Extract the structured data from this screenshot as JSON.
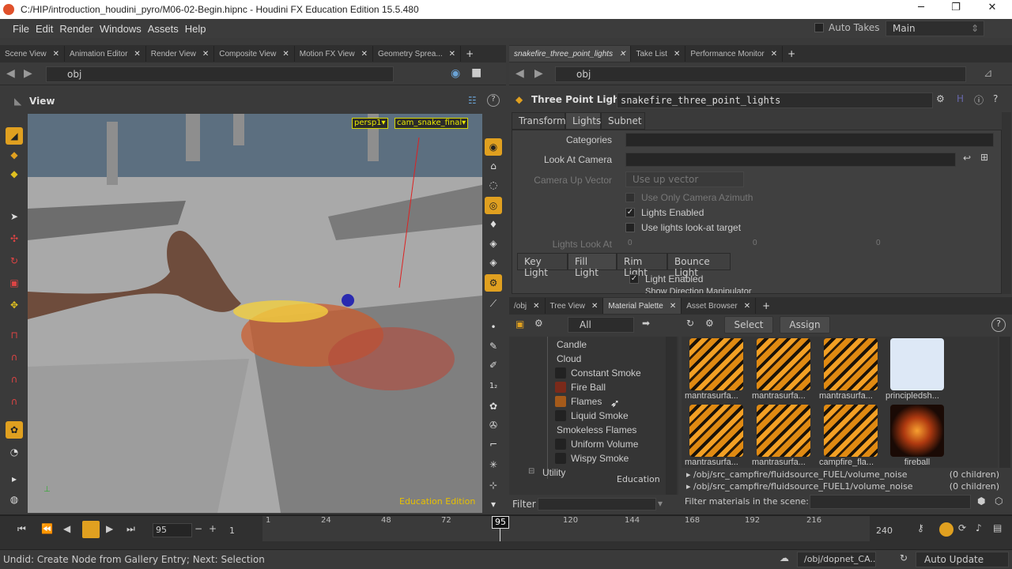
{
  "window": {
    "title": "C:/HIP/introduction_houdini_pyro/M06-02-Begin.hipnc - Houdini FX Education Edition 15.5.480",
    "min": "─",
    "max": "❐",
    "close": "✕"
  },
  "menu": [
    "File",
    "Edit",
    "Render",
    "Windows",
    "Assets",
    "Help"
  ],
  "auto_takes": "Auto Takes",
  "desktop": "Main",
  "left_tabs": [
    "Scene View",
    "Animation Editor",
    "Render View",
    "Composite View",
    "Motion FX View",
    "Geometry Sprea..."
  ],
  "left_path": "obj",
  "view_label": "View",
  "camera": {
    "persp": "persp1▾",
    "cam": "cam_snake_final▾"
  },
  "viewport_watermark": "Education Edition",
  "right_tabs": [
    "snakefire_three_point_lights",
    "Take List",
    "Performance Monitor"
  ],
  "right_path": "obj",
  "node": {
    "type": "Three Point Light",
    "name": "snakefire_three_point_lights"
  },
  "param_tabs": [
    "Transform",
    "Lights",
    "Subnet"
  ],
  "params": {
    "categories": "Categories",
    "look_at_camera": "Look At Camera",
    "camera_up_vector": "Camera Up Vector",
    "camera_up_value": "Use up vector",
    "use_only_azimuth": "Use Only Camera Azimuth",
    "lights_enabled": "Lights Enabled",
    "use_lookat": "Use lights look-at target",
    "lights_look_at": "Lights Look At",
    "look_vals": [
      "0",
      "0",
      "0"
    ]
  },
  "light_tabs": [
    "Key Light",
    "Fill Light",
    "Rim Light",
    "Bounce Light"
  ],
  "light_enabled": "Light Enabled",
  "show_dir": "Show Direction Manipulator",
  "bottom_tabs": [
    "/obj",
    "Tree View",
    "Material Palette",
    "Asset Browser"
  ],
  "filter_all": "All",
  "tree": [
    "Candle",
    "Cloud",
    "Constant Smoke",
    "Fire Ball",
    "Flames",
    "Liquid Smoke",
    "Smokeless Flames",
    "Uniform Volume",
    "Wispy Smoke",
    "Utility"
  ],
  "education_label": "Education",
  "filter_label": "Filter",
  "select_btn": "Select",
  "assign_btn": "Assign",
  "materials": [
    "mantrasurfa...",
    "mantrasurfa...",
    "mantrasurfa...",
    "principledsh...",
    "mantrasurfa...",
    "mantrasurfa...",
    "campfire_fla...",
    "fireball"
  ],
  "scene_materials": [
    {
      "path": "/obj/src_campfire/fluidsource_FUEL/volume_noise",
      "children": "(0 children)"
    },
    {
      "path": "/obj/src_campfire/fluidsource_FUEL1/volume_noise",
      "children": "(0 children)"
    }
  ],
  "filter_scene": "Filter materials in the scene:",
  "timeline": {
    "frame": "95",
    "start": "1",
    "end": "240",
    "ticks": [
      "1",
      "24",
      "48",
      "72",
      "120",
      "144",
      "168",
      "192",
      "216"
    ],
    "current": "95"
  },
  "status": "Undid: Create Node from Gallery Entry; Next: Selection",
  "dopnet": "/obj/dopnet_CA...",
  "auto_update": "Auto Update"
}
